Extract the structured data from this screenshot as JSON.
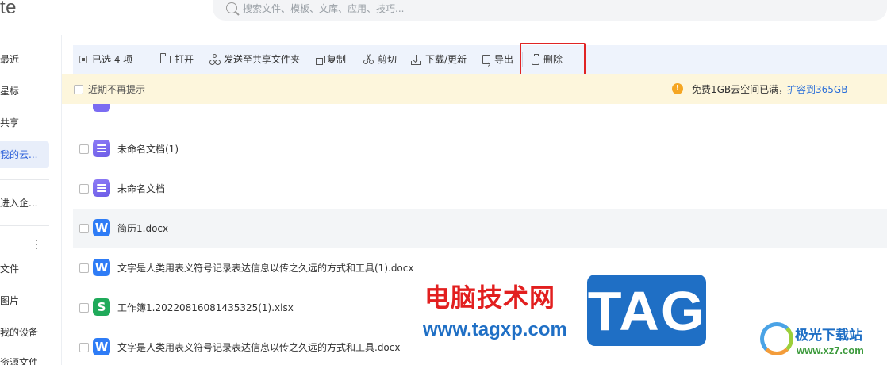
{
  "header": {
    "brand_fragment": "te",
    "search_placeholder": "搜索文件、模板、文库、应用、技巧..."
  },
  "sidebar": {
    "items": [
      {
        "label": "最近"
      },
      {
        "label": "星标"
      },
      {
        "label": "共享"
      },
      {
        "label": "我的云...",
        "active": true
      },
      {
        "label": "进入企..."
      },
      {
        "label": "文件"
      },
      {
        "label": "图片"
      },
      {
        "label": "我的设备"
      },
      {
        "label": "资源文件"
      }
    ]
  },
  "toolbar": {
    "selected": "已选 4 项",
    "open": "打开",
    "send_shared": "发送至共享文件夹",
    "copy": "复制",
    "cut": "剪切",
    "download": "下载/更新",
    "export": "导出",
    "delete": "删除"
  },
  "notice": {
    "dont_remind": "近期不再提示",
    "warning_icon": "!",
    "message": "免费1GB云空间已满，",
    "link": "扩容到365GB",
    "accent_color": "#f5a623"
  },
  "files": [
    {
      "name": "未命名文档(1)",
      "type": "doc"
    },
    {
      "name": "未命名文档",
      "type": "doc"
    },
    {
      "name": "简历1.docx",
      "type": "word",
      "hover": true
    },
    {
      "name": "文字是人类用表义符号记录表达信息以传之久远的方式和工具(1).docx",
      "type": "word"
    },
    {
      "name": "工作簿1.20220816081435325(1).xlsx",
      "type": "sheet"
    },
    {
      "name": "文字是人类用表义符号记录表达信息以传之久远的方式和工具.docx",
      "type": "word"
    }
  ],
  "file_icon_letters": {
    "word": "W",
    "sheet": "S"
  },
  "watermark": {
    "cn": "电脑技术网",
    "url": "www.tagxp.com",
    "tag": "TAG",
    "site_cn": "极光下载站",
    "site_url": "www.xz7.com"
  },
  "colors": {
    "highlight": "#e02424",
    "link": "#2b6fd9",
    "toolbar_bg": "#eef3fc",
    "notice_bg": "#fdf6dc"
  }
}
